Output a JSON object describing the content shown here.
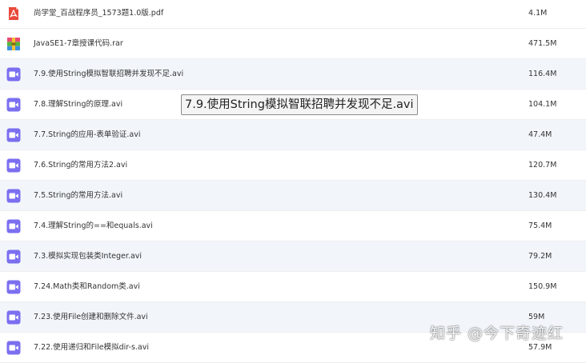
{
  "files": [
    {
      "name": "尚学堂_百战程序员_1573题1.0版.pdf",
      "size": "4.1M",
      "icon": "pdf-icon"
    },
    {
      "name": "JavaSE1-7章授课代码.rar",
      "size": "471.5M",
      "icon": "archive-icon"
    },
    {
      "name": "7.9.使用String模拟智联招聘并发现不足.avi",
      "size": "116.4M",
      "icon": "video-icon"
    },
    {
      "name": "7.8.理解String的原理.avi",
      "size": "104.1M",
      "icon": "video-icon"
    },
    {
      "name": "7.7.String的应用-表单验证.avi",
      "size": "47.4M",
      "icon": "video-icon"
    },
    {
      "name": "7.6.String的常用方法2.avi",
      "size": "120.7M",
      "icon": "video-icon"
    },
    {
      "name": "7.5.String的常用方法.avi",
      "size": "130.4M",
      "icon": "video-icon"
    },
    {
      "name": "7.4.理解String的==和equals.avi",
      "size": "75.4M",
      "icon": "video-icon"
    },
    {
      "name": "7.3.模拟实现包装类Integer.avi",
      "size": "79.2M",
      "icon": "video-icon"
    },
    {
      "name": "7.24.Math类和Random类.avi",
      "size": "150.9M",
      "icon": "video-icon"
    },
    {
      "name": "7.23.使用File创建和删除文件.avi",
      "size": "59M",
      "icon": "video-icon"
    },
    {
      "name": "7.22.使用递归和File模拟dir-s.avi",
      "size": "57.9M",
      "icon": "video-icon"
    }
  ],
  "tooltip": "7.9.使用String模拟智联招聘并发现不足.avi",
  "watermark": "知乎 @今下奇迹红",
  "colors": {
    "video_icon": "#7b6ff0",
    "pdf_icon": "#e8493a",
    "highlight_row": "#f2f6fb"
  }
}
